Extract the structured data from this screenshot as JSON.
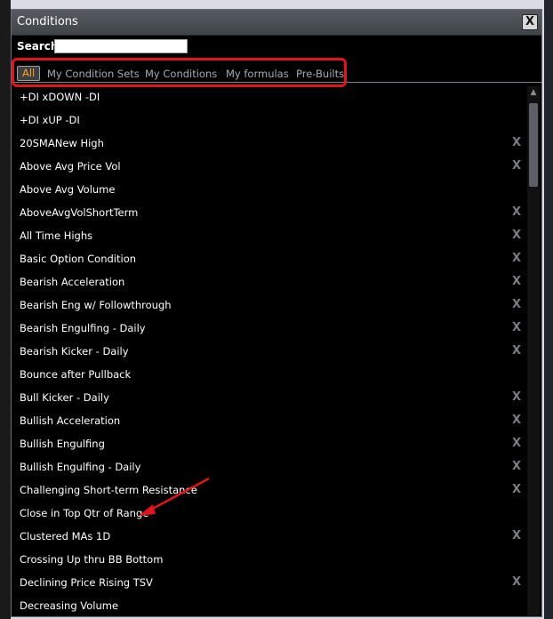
{
  "window": {
    "title": "Conditions",
    "close_label": "X"
  },
  "search": {
    "label": "Search",
    "value": ""
  },
  "tabs": [
    {
      "label": "All",
      "active": true
    },
    {
      "label": "My Condition Sets",
      "active": false
    },
    {
      "label": "My Conditions",
      "active": false
    },
    {
      "label": "My formulas",
      "active": false
    },
    {
      "label": "Pre-Builts",
      "active": false
    }
  ],
  "delete_label": "X",
  "conditions": [
    {
      "label": "+DI xDOWN -DI",
      "deletable": false
    },
    {
      "label": "+DI xUP -DI",
      "deletable": false
    },
    {
      "label": "20SMANew High",
      "deletable": true
    },
    {
      "label": "Above Avg Price Vol",
      "deletable": true
    },
    {
      "label": "Above Avg Volume",
      "deletable": false
    },
    {
      "label": "AboveAvgVolShortTerm",
      "deletable": true
    },
    {
      "label": "All Time Highs",
      "deletable": true
    },
    {
      "label": "Basic Option Condition",
      "deletable": true
    },
    {
      "label": "Bearish Acceleration",
      "deletable": true
    },
    {
      "label": "Bearish Eng w/ Followthrough",
      "deletable": true
    },
    {
      "label": "Bearish Engulfing - Daily",
      "deletable": true
    },
    {
      "label": "Bearish Kicker - Daily",
      "deletable": true
    },
    {
      "label": "Bounce after Pullback",
      "deletable": false
    },
    {
      "label": "Bull Kicker - Daily",
      "deletable": true
    },
    {
      "label": "Bullish Acceleration",
      "deletable": true
    },
    {
      "label": "Bullish Engulfing",
      "deletable": true
    },
    {
      "label": "Bullish Engulfing - Daily",
      "deletable": true
    },
    {
      "label": "Challenging Short-term Resistance",
      "deletable": true
    },
    {
      "label": "Close in Top Qtr of Range",
      "deletable": false
    },
    {
      "label": "Clustered MAs 1D",
      "deletable": true
    },
    {
      "label": "Crossing Up thru BB Bottom",
      "deletable": false
    },
    {
      "label": "Declining Price Rising TSV",
      "deletable": true
    },
    {
      "label": "Decreasing Volume",
      "deletable": false
    }
  ],
  "colors": {
    "active_tab": "#f3a12b",
    "highlight_box": "#e0141d",
    "annotation_arrow": "#e0141d"
  }
}
